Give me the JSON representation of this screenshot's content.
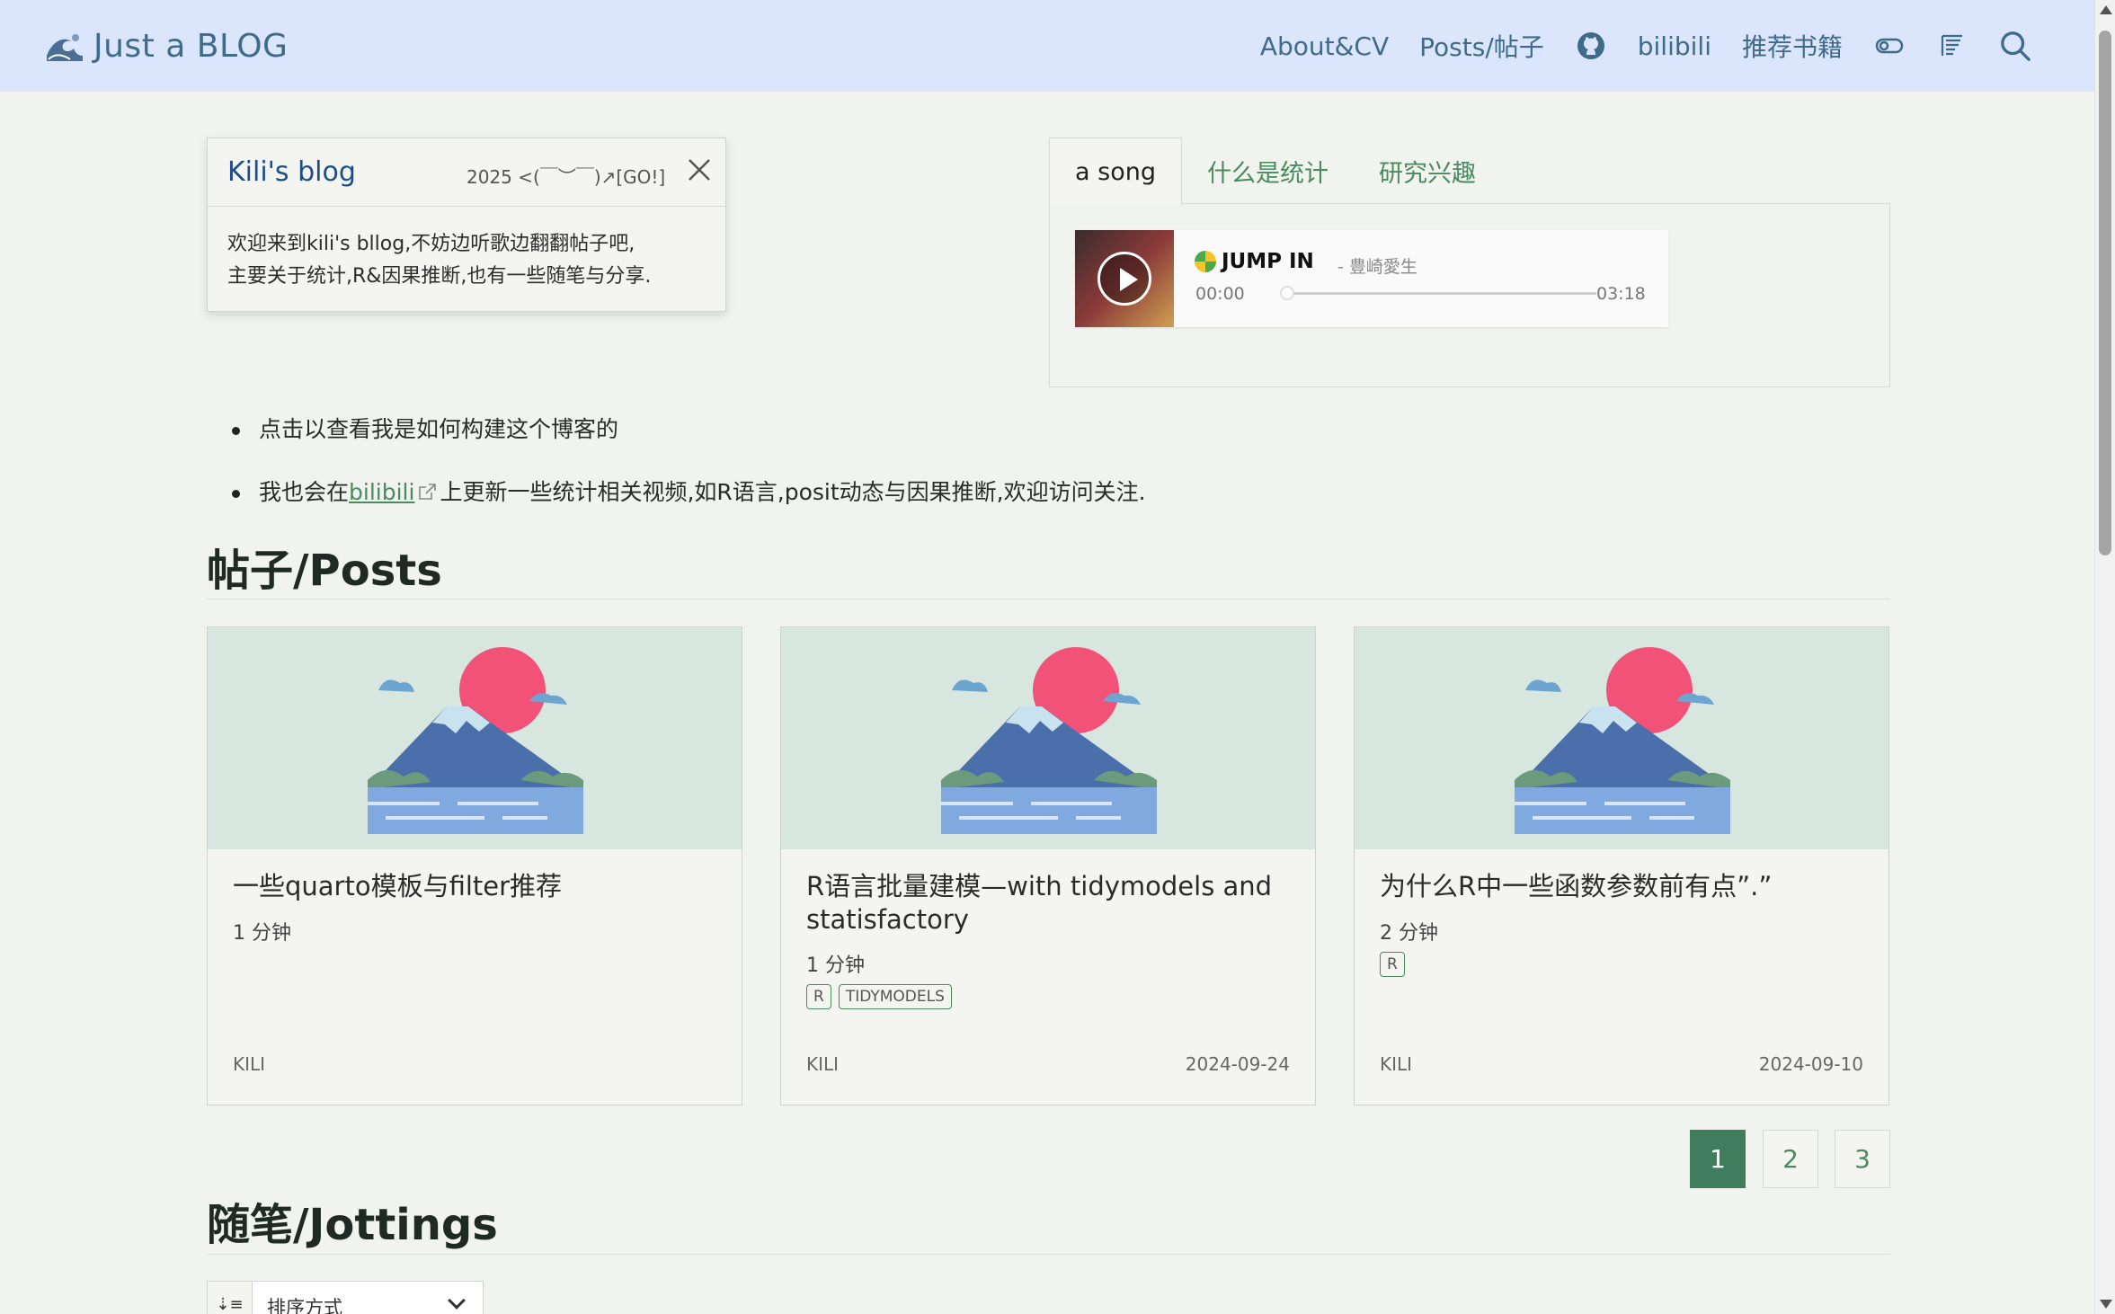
{
  "navbar": {
    "brand_title": "Just a BLOG",
    "links": {
      "about": "About&CV",
      "posts": "Posts/帖子",
      "bilibili": "bilibili",
      "books": "推荐书籍"
    },
    "icons": [
      "github-icon",
      "toggle-icon",
      "reader-icon",
      "search-icon"
    ]
  },
  "popup": {
    "title": "Kili's blog",
    "meta": "2025 <(￣︶￣)↗[GO!]",
    "body_line1": "欢迎来到kili's bllog,不妨边听歌边翻翻帖子吧,",
    "body_line2": "主要关于统计,R&因果推断,也有一些随笔与分享."
  },
  "tabs": {
    "items": [
      "a song",
      "什么是统计",
      "研究兴趣"
    ],
    "active": "a song"
  },
  "player": {
    "title": "JUMP IN",
    "artist": "- 豊崎愛生",
    "current_time": "00:00",
    "total_time": "03:18",
    "progress": 0
  },
  "bullets": {
    "item1": "点击以查看我是如何构建这个博客的",
    "item2_prefix": "我也会在",
    "item2_link": "bilibili",
    "item2_suffix": "上更新一些统计相关视频,如R语言,posit动态与因果推断,欢迎访问关注."
  },
  "sections": {
    "posts": "帖子/Posts",
    "jottings": "随笔/Jottings"
  },
  "posts": [
    {
      "title": "一些quarto模板与filter推荐",
      "read_time": "1 分钟",
      "tags": [],
      "author": "KILI",
      "date": ""
    },
    {
      "title": "R语言批量建模—with tidymodels and statisfactory",
      "read_time": "1 分钟",
      "tags": [
        "R",
        "TIDYMODELS"
      ],
      "author": "KILI",
      "date": "2024-09-24"
    },
    {
      "title": "为什么R中一些函数参数前有点”.”",
      "read_time": "2 分钟",
      "tags": [
        "R"
      ],
      "author": "KILI",
      "date": "2024-09-10"
    }
  ],
  "pagination": {
    "pages": [
      "1",
      "2",
      "3"
    ],
    "current": "1"
  },
  "sort": {
    "label": "排序方式",
    "icon": "sort-icon"
  },
  "colors": {
    "navbar_bg": "#dbe5fb",
    "accent": "#4a8a5e",
    "page_bg": "#f1f3ee",
    "active_page": "#3f7d5d"
  }
}
